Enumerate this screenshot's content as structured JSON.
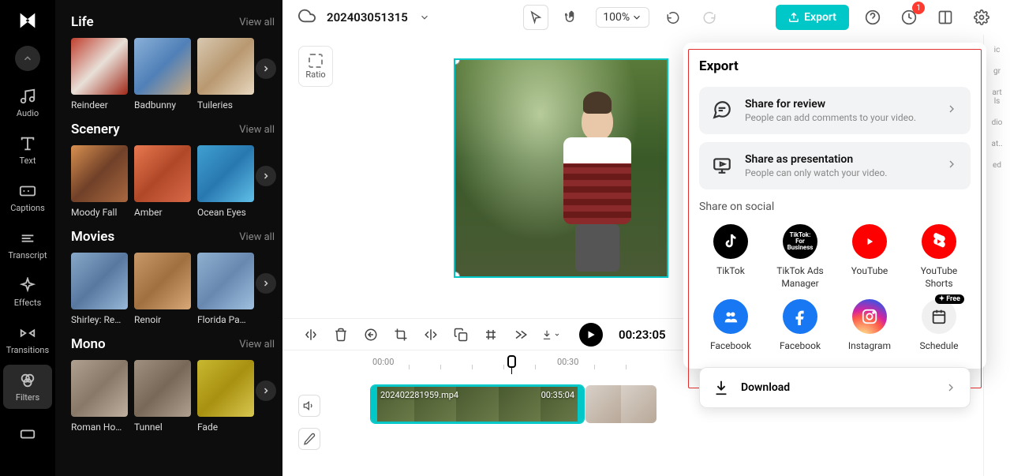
{
  "project_title": "202403051315",
  "zoom": "100%",
  "export_button": "Export",
  "notification_count": "1",
  "ratio_label": "Ratio",
  "sidebar": {
    "items": [
      {
        "label": "Audio"
      },
      {
        "label": "Text"
      },
      {
        "label": "Captions"
      },
      {
        "label": "Transcript"
      },
      {
        "label": "Effects"
      },
      {
        "label": "Transitions"
      },
      {
        "label": "Filters"
      }
    ]
  },
  "panel": {
    "view_all": "View all",
    "categories": [
      {
        "title": "Life",
        "items": [
          "Reindeer",
          "Badbunny",
          "Tuileries"
        ]
      },
      {
        "title": "Scenery",
        "items": [
          "Moody Fall",
          "Amber",
          "Ocean Eyes"
        ]
      },
      {
        "title": "Movies",
        "items": [
          "Shirley: Re…",
          "Renoir",
          "Florida Pa…"
        ]
      },
      {
        "title": "Mono",
        "items": [
          "Roman Ho…",
          "Tunnel",
          "Fade"
        ]
      }
    ]
  },
  "timecode": "00:23:05",
  "ruler": [
    "00:00",
    "00:30"
  ],
  "clip": {
    "name": "202402281959.mp4",
    "duration": "00:35:04"
  },
  "export_panel": {
    "title": "Export",
    "share_review": {
      "title": "Share for review",
      "sub": "People can add comments to your video."
    },
    "share_present": {
      "title": "Share as presentation",
      "sub": "People can only watch your video."
    },
    "social_header": "Share on social",
    "socials": [
      "TikTok",
      "TikTok Ads Manager",
      "YouTube",
      "YouTube Shorts",
      "Facebook",
      "Facebook",
      "Instagram",
      "Schedule"
    ],
    "free": "Free",
    "download": "Download"
  },
  "thumb_gradients": [
    [
      "#c04030",
      "#e8e0d8",
      "#a02818"
    ],
    [
      "#8ab0d8",
      "#5080b8",
      "#c8a880"
    ],
    [
      "#d8c8b0",
      "#b89870",
      "#e8d8c0"
    ],
    [
      "#d89050",
      "#704028",
      "#a86840"
    ],
    [
      "#e87850",
      "#b04828",
      "#d86848"
    ],
    [
      "#40a0d0",
      "#2878b0",
      "#60c0e8"
    ],
    [
      "#88a8c8",
      "#5878a0",
      "#98b8d8"
    ],
    [
      "#c89868",
      "#a07040",
      "#d8a878"
    ],
    [
      "#90b0d0",
      "#6888b0",
      "#a0c0e0"
    ],
    [
      "#b0a090",
      "#887868",
      "#c0b0a0"
    ],
    [
      "#a09080",
      "#786858",
      "#b0a090"
    ],
    [
      "#c8b830",
      "#a89010",
      "#d8c850"
    ]
  ]
}
